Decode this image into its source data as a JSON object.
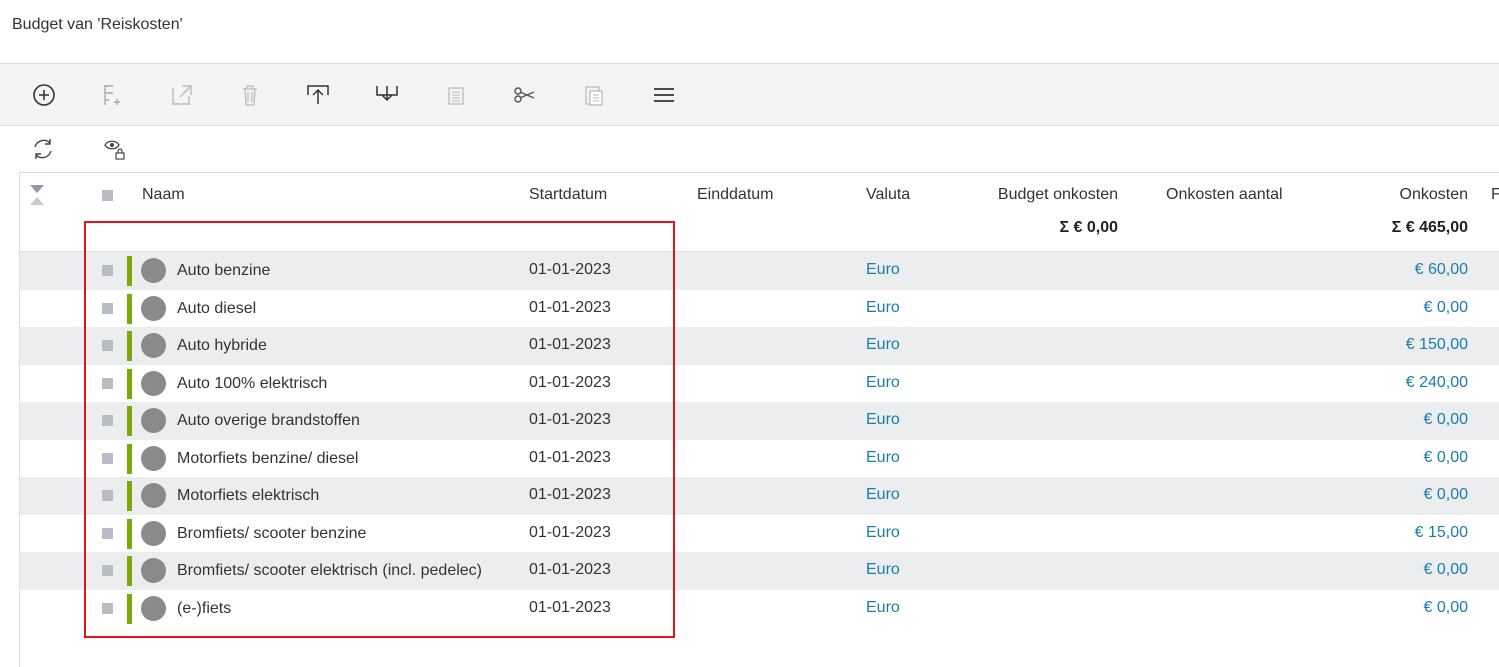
{
  "title": "Budget van 'Reiskosten'",
  "toolbar": {
    "icons": [
      "add-circle-icon",
      "add-column-icon",
      "open-external-icon",
      "trash-icon",
      "upload-icon",
      "download-icon",
      "copy-doc-icon",
      "scissors-icon",
      "paste-icon",
      "menu-icon"
    ]
  },
  "subtoolbar": {
    "icons": [
      "refresh-icon",
      "visibility-lock-icon"
    ]
  },
  "table": {
    "columns": {
      "name": "Naam",
      "start": "Startdatum",
      "end": "Einddatum",
      "currency": "Valuta",
      "budget": "Budget onkosten",
      "count": "Onkosten aantal",
      "cost": "Onkosten",
      "cut": "F"
    },
    "sums": {
      "budget": "Σ € 0,00",
      "cost": "Σ € 465,00"
    },
    "rows": [
      {
        "name": "Auto benzine",
        "start": "01-01-2023",
        "currency": "Euro",
        "cost": "€ 60,00"
      },
      {
        "name": "Auto diesel",
        "start": "01-01-2023",
        "currency": "Euro",
        "cost": "€ 0,00"
      },
      {
        "name": "Auto hybride",
        "start": "01-01-2023",
        "currency": "Euro",
        "cost": "€ 150,00"
      },
      {
        "name": "Auto 100% elektrisch",
        "start": "01-01-2023",
        "currency": "Euro",
        "cost": "€ 240,00"
      },
      {
        "name": "Auto overige brandstoffen",
        "start": "01-01-2023",
        "currency": "Euro",
        "cost": "€ 0,00"
      },
      {
        "name": "Motorfiets benzine/ diesel",
        "start": "01-01-2023",
        "currency": "Euro",
        "cost": "€ 0,00"
      },
      {
        "name": "Motorfiets elektrisch",
        "start": "01-01-2023",
        "currency": "Euro",
        "cost": "€ 0,00"
      },
      {
        "name": "Bromfiets/ scooter benzine",
        "start": "01-01-2023",
        "currency": "Euro",
        "cost": "€ 15,00"
      },
      {
        "name": "Bromfiets/ scooter elektrisch (incl. pedelec)",
        "start": "01-01-2023",
        "currency": "Euro",
        "cost": "€ 0,00"
      },
      {
        "name": "(e-)fiets",
        "start": "01-01-2023",
        "currency": "Euro",
        "cost": "€ 0,00"
      }
    ]
  },
  "colors": {
    "link": "#1a7ea8",
    "status_bar": "#7aaa0a",
    "highlight": "#e0141c",
    "row_alt": "#ecedef"
  }
}
